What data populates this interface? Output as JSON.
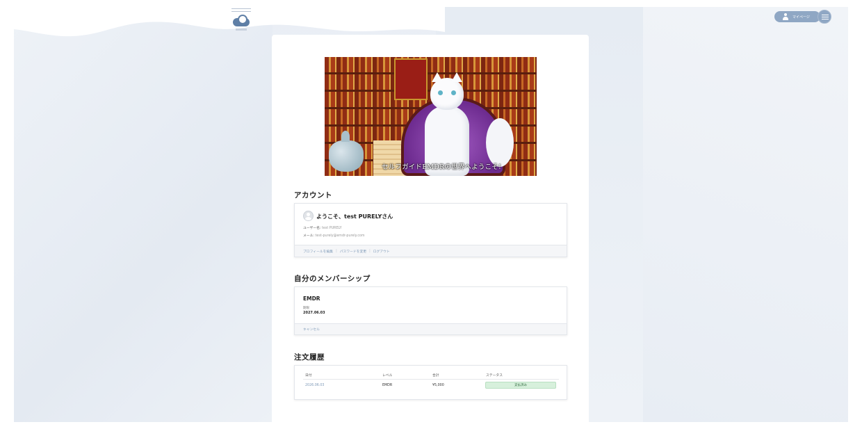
{
  "header": {
    "mypage_label": "マイページ",
    "brand_icon": "logo-icon",
    "menu_icon": "hamburger-icon",
    "accent_color": "#8fa7c4"
  },
  "hero": {
    "caption": "セルフガイドEMDRの世界へようこそ!"
  },
  "account": {
    "section_title": "アカウント",
    "welcome": "ようこそ、test PURELYさん",
    "username_label": "ユーザー名:",
    "username_value": "test PURELY",
    "email_label": "メール:",
    "email_value": "test-purely@emdr-purely.com",
    "links": [
      "プロフィールを編集",
      "パスワードを変更",
      "ログアウト"
    ],
    "link_separator": "|"
  },
  "membership": {
    "section_title": "自分のメンバーシップ",
    "name": "EMDR",
    "expiry_label": "期限",
    "expiry_date": "2027.06.03",
    "cancel_label": "キャンセル"
  },
  "orders": {
    "section_title": "注文履歴",
    "columns": [
      "日付",
      "レベル",
      "合計",
      "ステータス"
    ],
    "rows": [
      {
        "date": "2026.06.03",
        "level": "EMDR",
        "total": "¥5,000",
        "status": "支払済み"
      }
    ],
    "status_color": "#d7f0dc"
  }
}
